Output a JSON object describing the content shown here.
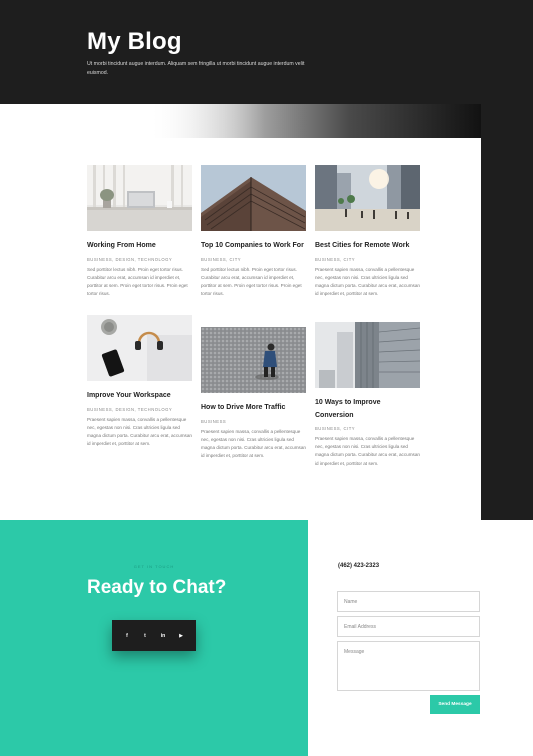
{
  "hero": {
    "title": "My Blog",
    "subtitle": "Ut morbi tincidunt augue interdum. Aliquam sem fringilla ut morbi tincidunt augue interdum velit euismod."
  },
  "posts": [
    {
      "title": "Working From Home",
      "categories": "BUSINESS, DESIGN, TECHNOLOGY",
      "excerpt": "Sed porttitor lectus nibh. Proin eget tortor risus. Curabitur arcu erat, accumsan id imperdiet et, porttitor at sem. Proin eget tortor risus. Proin eget tortor risus."
    },
    {
      "title": "Top 10 Companies to Work For",
      "categories": "BUSINESS, CITY",
      "excerpt": "Sed porttitor lectus nibh. Proin eget tortor risus. Curabitur arcu erat, accumsan id imperdiet et, porttitor at sem. Proin eget tortor risus. Proin eget tortor risus."
    },
    {
      "title": "Best Cities for Remote Work",
      "categories": "BUSINESS, CITY",
      "excerpt": "Praesent sapien massa, convallis a pellentesque nec, egestas non nisi. Cras ultricies ligula sed magna dictum porta. Curabitur arcu erat, accumsan id imperdiet et, porttitor at sem."
    },
    {
      "title": "Improve Your Workspace",
      "categories": "BUSINESS, DESIGN, TECHNOLOGY",
      "excerpt": "Praesent sapien massa, convallis a pellentesque nec, egestas non nisi. Cras ultricies ligula sed magna dictum porta. Curabitur arcu erat, accumsan id imperdiet et, porttitor at sem."
    },
    {
      "title": "How to Drive More Traffic",
      "categories": "BUSINESS",
      "excerpt": "Praesent sapien massa, convallis a pellentesque nec, egestas non nisi. Cras ultricies ligula sed magna dictum porta. Curabitur arcu erat, accumsan id imperdiet et, porttitor at sem."
    },
    {
      "title": "10 Ways to Improve Conversion",
      "categories": "BUSINESS, CITY",
      "excerpt": "Praesent sapien massa, convallis a pellentesque nec, egestas non nisi. Cras ultricies ligula sed magna dictum porta. Curabitur arcu erat, accumsan id imperdiet et, porttitor at sem."
    }
  ],
  "contact": {
    "kicker": "GET IN TOUCH",
    "heading": "Ready to Chat?",
    "phone": "(462) 423-2323",
    "social": [
      {
        "icon": "facebook-icon",
        "glyph": "f"
      },
      {
        "icon": "twitter-icon",
        "glyph": "t"
      },
      {
        "icon": "linkedin-icon",
        "glyph": "in"
      },
      {
        "icon": "youtube-icon",
        "glyph": "▶"
      }
    ],
    "name_placeholder": "Name",
    "email_placeholder": "Email Address",
    "message_placeholder": "Message",
    "send_label": "Send Message"
  },
  "colors": {
    "dark": "#1e1e1e",
    "accent": "#2cc9a8"
  }
}
